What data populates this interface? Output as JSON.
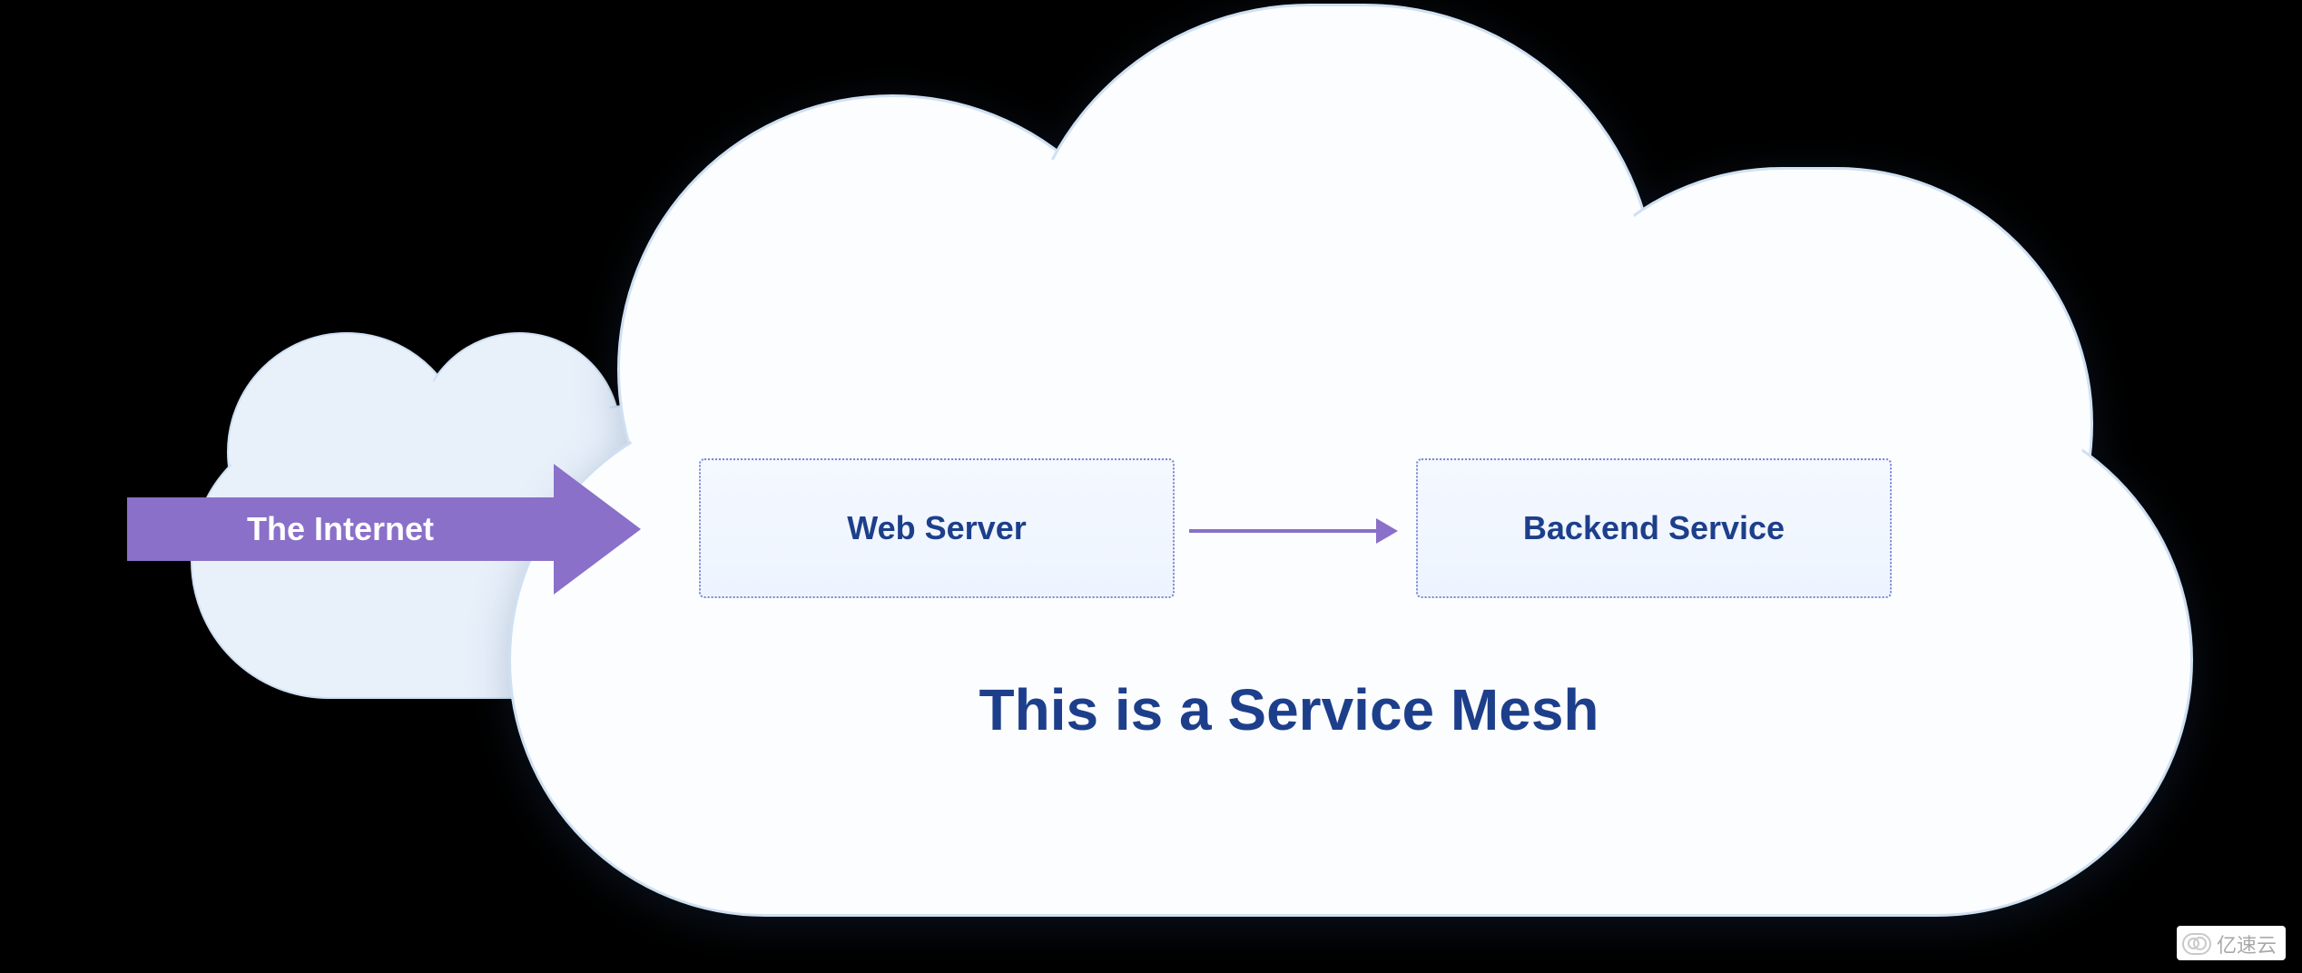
{
  "internet": {
    "label": "The Internet"
  },
  "mesh": {
    "caption": "This is a Service Mesh",
    "web_server": "Web Server",
    "backend_service": "Backend Service"
  },
  "watermark": "亿速云"
}
